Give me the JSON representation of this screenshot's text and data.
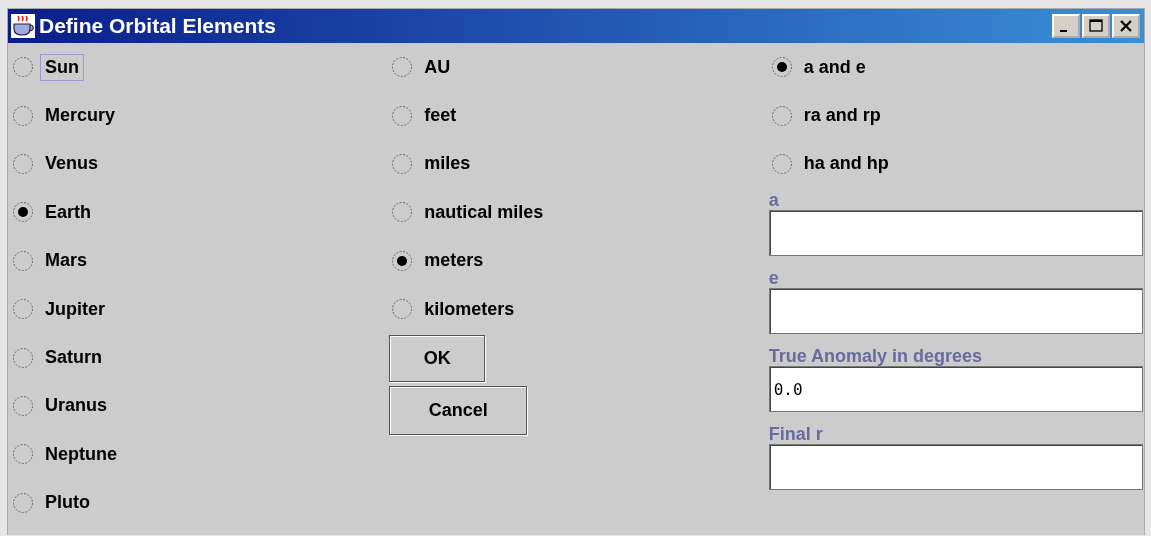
{
  "window": {
    "title": "Define Orbital Elements"
  },
  "bodies": [
    {
      "label": "Sun",
      "selected": false,
      "focused": true
    },
    {
      "label": "Mercury",
      "selected": false,
      "focused": false
    },
    {
      "label": "Venus",
      "selected": false,
      "focused": false
    },
    {
      "label": "Earth",
      "selected": true,
      "focused": false
    },
    {
      "label": "Mars",
      "selected": false,
      "focused": false
    },
    {
      "label": "Jupiter",
      "selected": false,
      "focused": false
    },
    {
      "label": "Saturn",
      "selected": false,
      "focused": false
    },
    {
      "label": "Uranus",
      "selected": false,
      "focused": false
    },
    {
      "label": "Neptune",
      "selected": false,
      "focused": false
    },
    {
      "label": "Pluto",
      "selected": false,
      "focused": false
    }
  ],
  "units": [
    {
      "label": "AU",
      "selected": false
    },
    {
      "label": "feet",
      "selected": false
    },
    {
      "label": "miles",
      "selected": false
    },
    {
      "label": "nautical miles",
      "selected": false
    },
    {
      "label": "meters",
      "selected": true
    },
    {
      "label": "kilometers",
      "selected": false
    }
  ],
  "buttons": [
    {
      "label": "OK",
      "kind": "ok"
    },
    {
      "label": "Cancel",
      "kind": "cancel"
    }
  ],
  "element_pairs": [
    {
      "label": "a and e",
      "selected": true
    },
    {
      "label": "ra and rp",
      "selected": false
    },
    {
      "label": "ha and hp",
      "selected": false
    }
  ],
  "fields": [
    {
      "label": "a"
    },
    {
      "label": "e"
    },
    {
      "label": "True Anomaly in degrees",
      "value": "0.0"
    },
    {
      "label": "Final r"
    }
  ]
}
